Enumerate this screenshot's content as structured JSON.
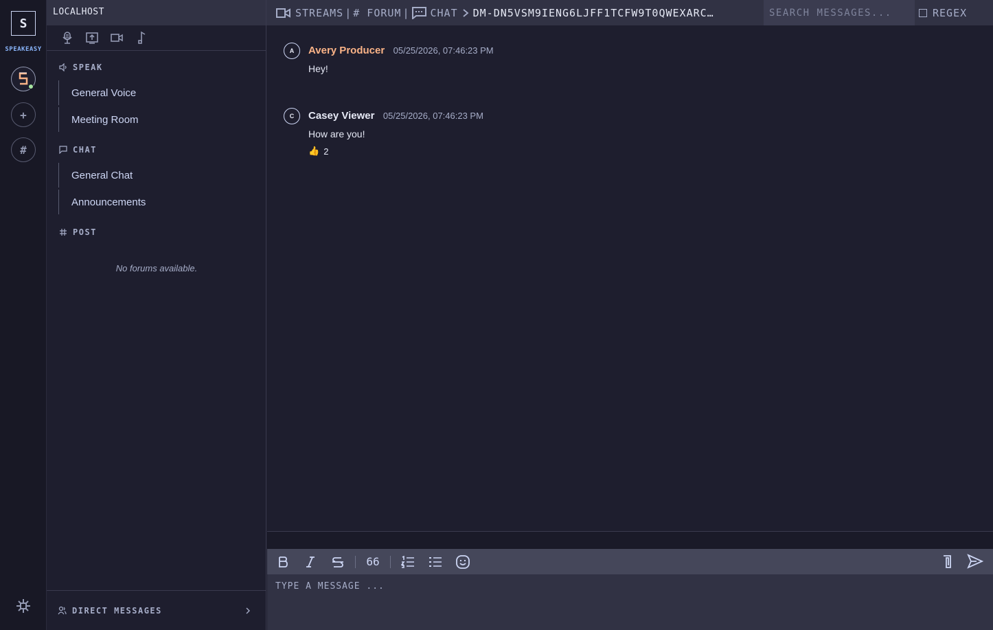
{
  "app": {
    "logo_letter": "S",
    "name": "SPEAKEASY"
  },
  "servers": [
    {
      "name": "localhost",
      "initial": "S",
      "online": true
    }
  ],
  "rail": {
    "add_server": "+",
    "browse": "#"
  },
  "sidebar": {
    "server_name": "LOCALHOST",
    "media_icons": [
      "microphone-icon",
      "screen-share-icon",
      "camera-icon",
      "music-icon"
    ],
    "sections": {
      "speak": {
        "title": "SPEAK",
        "channels": [
          "General Voice",
          "Meeting Room"
        ]
      },
      "chat": {
        "title": "CHAT",
        "channels": [
          "General Chat",
          "Announcements"
        ]
      },
      "post": {
        "title": "POST",
        "empty_text": "No forums available."
      }
    },
    "direct_messages": "DIRECT MESSAGES"
  },
  "topbar": {
    "streams": "STREAMS",
    "forum": "# FORUM",
    "chat": "CHAT",
    "chat_path": "DM-DN5VSM9IENG6LJFF1TCFW9T0QWEXARC…",
    "search_placeholder": "SEARCH MESSAGES...",
    "regex_label": "REGEX",
    "regex_checked": false
  },
  "messages": [
    {
      "initial": "A",
      "author": "Avery Producer",
      "author_color": "#fab387",
      "timestamp": "05/25/2026, 07:46:23 PM",
      "text": "Hey!"
    },
    {
      "initial": "C",
      "author": "Casey Viewer",
      "author_color": "#e6e9f5",
      "timestamp": "05/25/2026, 07:46:23 PM",
      "text": "How are you!",
      "reaction": {
        "emoji": "👍",
        "count": "2"
      }
    }
  ],
  "composer": {
    "format_buttons": [
      "bold-icon",
      "italic-icon",
      "strikethrough-icon",
      "quote-icon",
      "ordered-list-icon",
      "bullet-list-icon",
      "emoji-icon"
    ],
    "quote_glyph": "66",
    "placeholder": "TYPE A MESSAGE ..."
  },
  "colors": {
    "accent": "#89b4fa",
    "online": "#a6e3a1",
    "bg": "#1e1e2e",
    "panel": "#313244"
  }
}
